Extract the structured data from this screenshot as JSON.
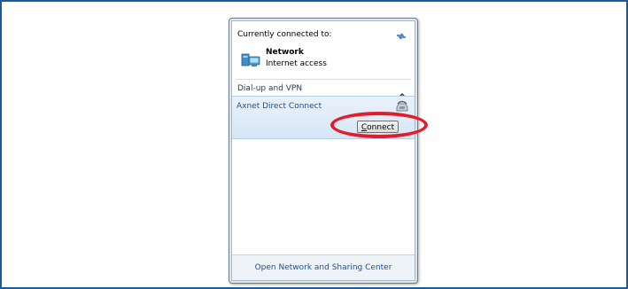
{
  "popup": {
    "current": {
      "label": "Currently connected to:",
      "refresh_icon": "refresh-icon",
      "network": {
        "icon": "network-icon",
        "name": "Network",
        "status": "Internet access"
      }
    },
    "group": {
      "label": "Dial-up and VPN",
      "collapse_icon": "chevron-up-icon"
    },
    "connection": {
      "name": "Axnet Direct Connect",
      "icon": "dialup-phone-icon",
      "button_accel": "C",
      "button_rest": "onnect"
    },
    "footer": {
      "link": "Open Network and Sharing Center"
    }
  },
  "colors": {
    "frame_border": "#1a5b9e",
    "highlight": "#e21d2b",
    "link": "#1c4f9a",
    "selected_bg": "#d7e6f6"
  }
}
